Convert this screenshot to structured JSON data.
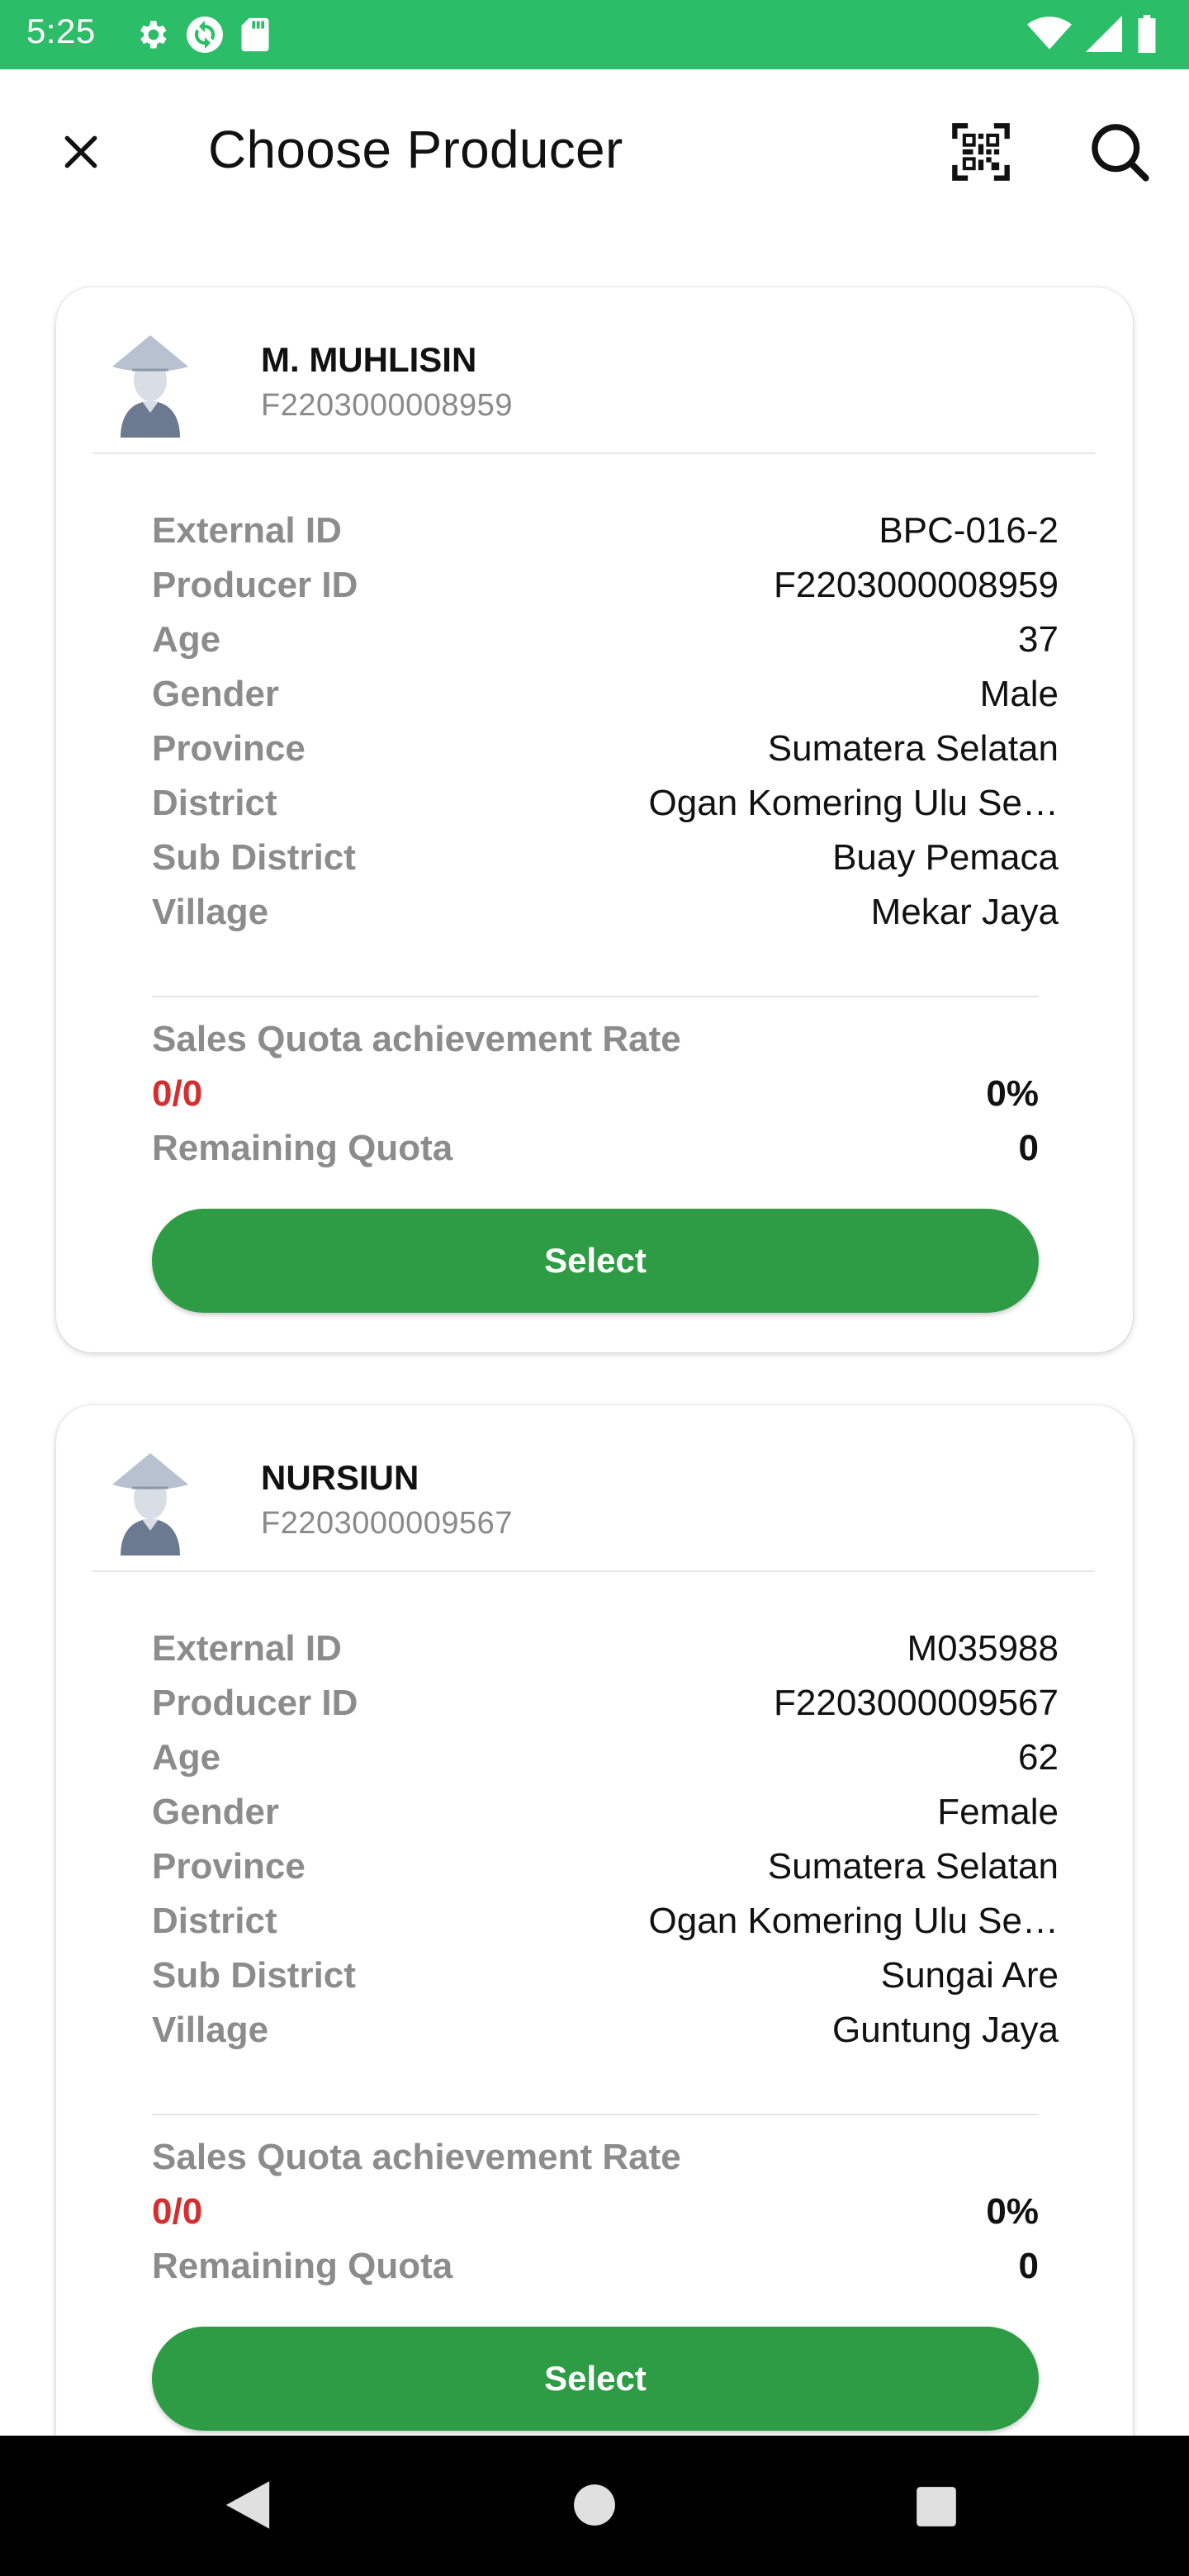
{
  "status_bar": {
    "time": "5:25",
    "left_icons": [
      "gear-icon",
      "sync-icon",
      "sd-card-icon"
    ],
    "right_icons": [
      "wifi-icon",
      "signal-icon",
      "battery-icon"
    ],
    "color": "#2bbd68"
  },
  "app_bar": {
    "title": "Choose Producer",
    "close_icon": "close-icon",
    "qr_icon": "qr-code-scan-icon",
    "search_icon": "search-icon"
  },
  "producers": [
    {
      "name": "M. MUHLISIN",
      "code": "F2203000008959",
      "details": [
        {
          "label": "External ID",
          "value": "BPC-016-2"
        },
        {
          "label": "Producer ID",
          "value": "F2203000008959"
        },
        {
          "label": "Age",
          "value": "37"
        },
        {
          "label": "Gender",
          "value": "Male"
        },
        {
          "label": "Province",
          "value": "Sumatera Selatan"
        },
        {
          "label": "District",
          "value": "Ogan Komering Ulu Se…"
        },
        {
          "label": "Sub District",
          "value": "Buay Pemaca"
        },
        {
          "label": "Village",
          "value": "Mekar Jaya"
        }
      ],
      "quota": {
        "rate_label": "Sales Quota achievement Rate",
        "ratio": "0/0",
        "percent": "0%",
        "remaining_label": "Remaining Quota",
        "remaining_value": "0"
      },
      "select_label": "Select"
    },
    {
      "name": "NURSIUN",
      "code": "F2203000009567",
      "details": [
        {
          "label": "External ID",
          "value": "M035988"
        },
        {
          "label": "Producer ID",
          "value": "F2203000009567"
        },
        {
          "label": "Age",
          "value": "62"
        },
        {
          "label": "Gender",
          "value": "Female"
        },
        {
          "label": "Province",
          "value": "Sumatera Selatan"
        },
        {
          "label": "District",
          "value": "Ogan Komering Ulu Se…"
        },
        {
          "label": "Sub District",
          "value": "Sungai Are"
        },
        {
          "label": "Village",
          "value": "Guntung Jaya"
        }
      ],
      "quota": {
        "rate_label": "Sales Quota achievement Rate",
        "ratio": "0/0",
        "percent": "0%",
        "remaining_label": "Remaining Quota",
        "remaining_value": "0"
      },
      "select_label": "Select"
    }
  ],
  "colors": {
    "accent_green": "#2e9b45",
    "quota_red": "#d32f2f",
    "label_gray": "#8c8c8c"
  },
  "nav_bar": {
    "icons": [
      "back-triangle-icon",
      "home-circle-icon",
      "recents-square-icon"
    ]
  }
}
